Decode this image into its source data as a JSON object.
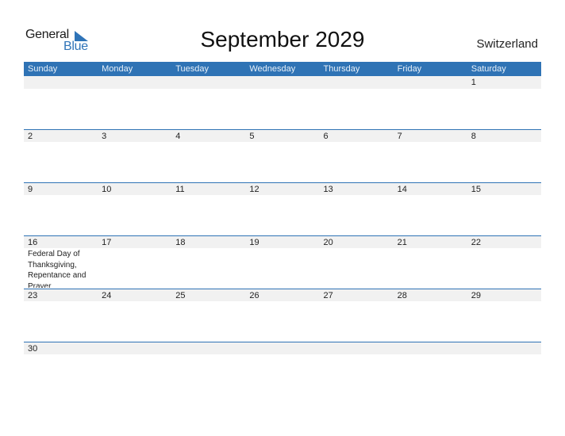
{
  "logo": {
    "word1": "General",
    "word2": "Blue"
  },
  "title": "September 2029",
  "country": "Switzerland",
  "colors": {
    "accent": "#2f73b5",
    "date_strip": "#f1f1f1"
  },
  "weekdays": [
    "Sunday",
    "Monday",
    "Tuesday",
    "Wednesday",
    "Thursday",
    "Friday",
    "Saturday"
  ],
  "weeks": [
    {
      "days": [
        "",
        "",
        "",
        "",
        "",
        "",
        "1"
      ],
      "events": [
        "",
        "",
        "",
        "",
        "",
        "",
        ""
      ]
    },
    {
      "days": [
        "2",
        "3",
        "4",
        "5",
        "6",
        "7",
        "8"
      ],
      "events": [
        "",
        "",
        "",
        "",
        "",
        "",
        ""
      ]
    },
    {
      "days": [
        "9",
        "10",
        "11",
        "12",
        "13",
        "14",
        "15"
      ],
      "events": [
        "",
        "",
        "",
        "",
        "",
        "",
        ""
      ]
    },
    {
      "days": [
        "16",
        "17",
        "18",
        "19",
        "20",
        "21",
        "22"
      ],
      "events": [
        "Federal Day of Thanksgiving, Repentance and Prayer",
        "",
        "",
        "",
        "",
        "",
        ""
      ]
    },
    {
      "days": [
        "23",
        "24",
        "25",
        "26",
        "27",
        "28",
        "29"
      ],
      "events": [
        "",
        "",
        "",
        "",
        "",
        "",
        ""
      ]
    },
    {
      "days": [
        "30",
        "",
        "",
        "",
        "",
        "",
        ""
      ],
      "events": [
        "",
        "",
        "",
        "",
        "",
        "",
        ""
      ]
    }
  ]
}
